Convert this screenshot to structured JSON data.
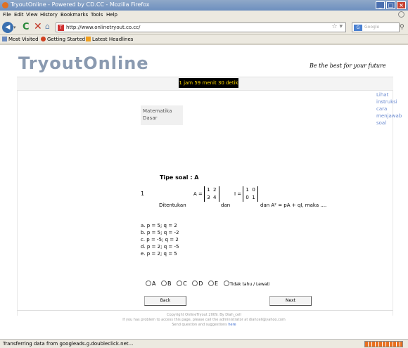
{
  "window": {
    "title": "TryoutOnline - Powered by CD.CC - Mozilla Firefox"
  },
  "menu": [
    "File",
    "Edit",
    "View",
    "History",
    "Bookmarks",
    "Tools",
    "Help"
  ],
  "nav": {
    "url": "http://www.onlinetryout.co.cc/",
    "search_placeholder": "Google"
  },
  "bookmarks": [
    "Most Visited",
    "Getting Started",
    "Latest Headlines"
  ],
  "page": {
    "logo": "TryoutOnline",
    "tagline": "Be the best for your future",
    "timer": "1 jam 59 menit 30 detik",
    "subject": "Matematika Dasar",
    "instructions_link": "Lihat instruksi cara menjawab soal",
    "question_type": "Tipe soal : A",
    "question_number": "1",
    "question": {
      "lead": "Ditentukan",
      "a_label": "A =",
      "a_matrix": [
        [
          "1",
          "2"
        ],
        [
          "3",
          "4"
        ]
      ],
      "and1": "dan",
      "i_label": "I =",
      "i_matrix": [
        [
          "1",
          "0"
        ],
        [
          "0",
          "1"
        ]
      ],
      "and2": "dan A² = pA + qI, maka ...."
    },
    "options": [
      "a. p = 5; q = 2",
      "b. p = 5; q = -2",
      "c. p = -5; q = 2",
      "d. p = 2; q = -5",
      "e. p = 2; q = 5"
    ],
    "answer_choices": [
      "A",
      "B",
      "C",
      "D",
      "E",
      "Tidak tahu / Lewati"
    ],
    "back_button": "Back",
    "next_button": "Next",
    "footer_line1": "Copyright OnlineTryout 2009. By Diah_cell",
    "footer_line2": "If you has problem to access this page, please call the administrator at diahcell@yahoo.com",
    "footer_line3": "Send question and suggestions",
    "footer_link": "here"
  },
  "status": {
    "text": "Transferring data from googleads.g.doubleclick.net...",
    "progress": 1.0
  },
  "colors": {
    "timer_bg": "#000000",
    "timer_fg": "#ffd800",
    "logo": "#8a9ab0",
    "link": "#6a8ad0"
  }
}
